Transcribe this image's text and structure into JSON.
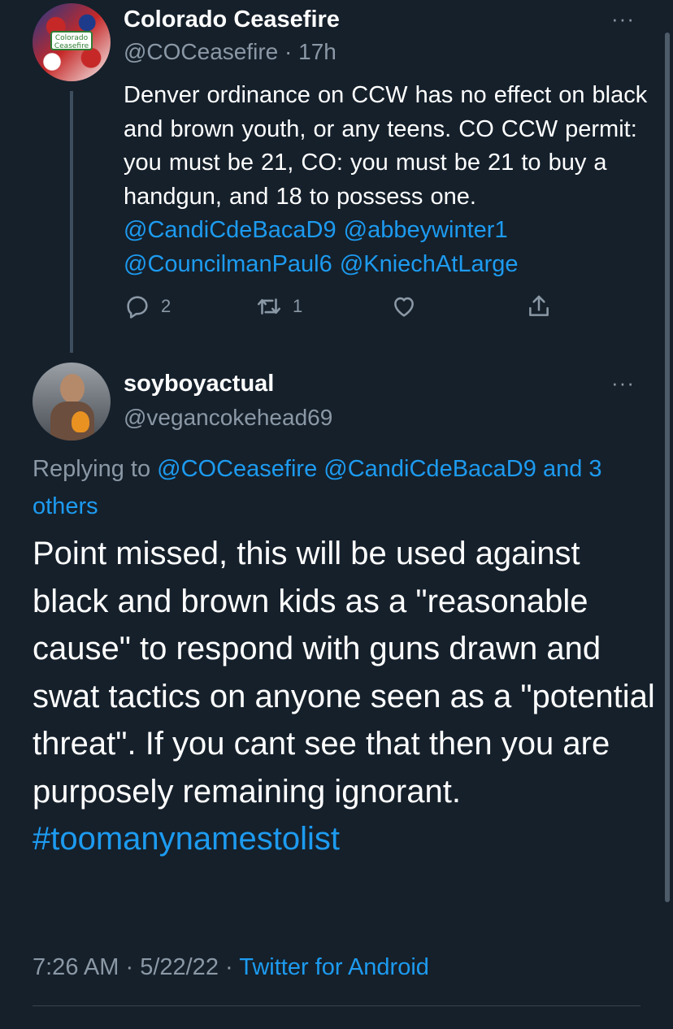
{
  "colors": {
    "background": "#15202b",
    "link": "#1d9bf0",
    "muted": "#8b98a5"
  },
  "parent_tweet": {
    "display_name": "Colorado Ceasefire",
    "handle": "@COCeasefire",
    "separator": " · ",
    "time_ago": "17h",
    "avatar_text": "Colorado Ceasefire",
    "more_label": "···",
    "text_segments": [
      {
        "text": "Denver ordinance on CCW has no effect on black and brown youth, or any teens.  CO CCW permit:  you must be 21, CO: you must be 21 to buy a handgun, and 18 to possess one.  ",
        "link": false
      },
      {
        "text": "@CandiCdeBacaD9",
        "link": true
      },
      {
        "text": "  ",
        "link": false
      },
      {
        "text": "@abbeywinter1",
        "link": true
      },
      {
        "text": " ",
        "link": false
      },
      {
        "text": "@CouncilmanPaul6",
        "link": true
      },
      {
        "text": "  ",
        "link": false
      },
      {
        "text": "@KniechAtLarge",
        "link": true
      }
    ],
    "actions": {
      "reply_icon": "reply-icon",
      "reply_count": "2",
      "retweet_icon": "retweet-icon",
      "retweet_count": "1",
      "like_icon": "heart-icon",
      "share_icon": "share-icon"
    }
  },
  "reply_tweet": {
    "display_name": "soyboyactual",
    "handle": "@vegancokehead69",
    "more_label": "···",
    "replying_prefix": "Replying to ",
    "replying_links": [
      "@COCeasefire",
      "@CandiCdeBacaD9",
      "and 3 others"
    ],
    "text": "Point missed, this will be used against black and brown kids as a \"reasonable cause\" to respond with guns drawn and swat tactics on anyone seen as a \"potential threat\". If you cant see that then you are purposely remaining ignorant. ",
    "hashtag": "#toomanynamestolist",
    "time": "7:26 AM",
    "date": "5/22/22",
    "meta_separator": " · ",
    "source": "Twitter for Android"
  }
}
